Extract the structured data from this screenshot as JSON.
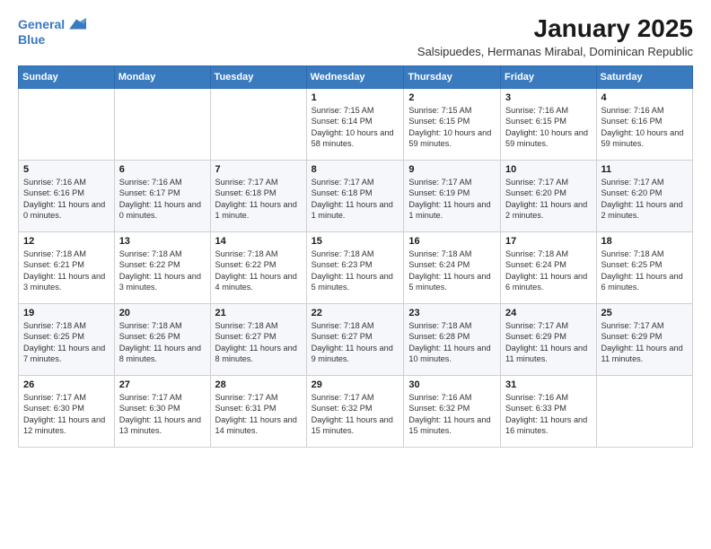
{
  "logo": {
    "line1": "General",
    "line2": "Blue"
  },
  "title": "January 2025",
  "subtitle": "Salsipuedes, Hermanas Mirabal, Dominican Republic",
  "days_of_week": [
    "Sunday",
    "Monday",
    "Tuesday",
    "Wednesday",
    "Thursday",
    "Friday",
    "Saturday"
  ],
  "weeks": [
    [
      {
        "day": "",
        "info": ""
      },
      {
        "day": "",
        "info": ""
      },
      {
        "day": "",
        "info": ""
      },
      {
        "day": "1",
        "info": "Sunrise: 7:15 AM\nSunset: 6:14 PM\nDaylight: 10 hours\nand 58 minutes."
      },
      {
        "day": "2",
        "info": "Sunrise: 7:15 AM\nSunset: 6:15 PM\nDaylight: 10 hours\nand 59 minutes."
      },
      {
        "day": "3",
        "info": "Sunrise: 7:16 AM\nSunset: 6:15 PM\nDaylight: 10 hours\nand 59 minutes."
      },
      {
        "day": "4",
        "info": "Sunrise: 7:16 AM\nSunset: 6:16 PM\nDaylight: 10 hours\nand 59 minutes."
      }
    ],
    [
      {
        "day": "5",
        "info": "Sunrise: 7:16 AM\nSunset: 6:16 PM\nDaylight: 11 hours\nand 0 minutes."
      },
      {
        "day": "6",
        "info": "Sunrise: 7:16 AM\nSunset: 6:17 PM\nDaylight: 11 hours\nand 0 minutes."
      },
      {
        "day": "7",
        "info": "Sunrise: 7:17 AM\nSunset: 6:18 PM\nDaylight: 11 hours\nand 1 minute."
      },
      {
        "day": "8",
        "info": "Sunrise: 7:17 AM\nSunset: 6:18 PM\nDaylight: 11 hours\nand 1 minute."
      },
      {
        "day": "9",
        "info": "Sunrise: 7:17 AM\nSunset: 6:19 PM\nDaylight: 11 hours\nand 1 minute."
      },
      {
        "day": "10",
        "info": "Sunrise: 7:17 AM\nSunset: 6:20 PM\nDaylight: 11 hours\nand 2 minutes."
      },
      {
        "day": "11",
        "info": "Sunrise: 7:17 AM\nSunset: 6:20 PM\nDaylight: 11 hours\nand 2 minutes."
      }
    ],
    [
      {
        "day": "12",
        "info": "Sunrise: 7:18 AM\nSunset: 6:21 PM\nDaylight: 11 hours\nand 3 minutes."
      },
      {
        "day": "13",
        "info": "Sunrise: 7:18 AM\nSunset: 6:22 PM\nDaylight: 11 hours\nand 3 minutes."
      },
      {
        "day": "14",
        "info": "Sunrise: 7:18 AM\nSunset: 6:22 PM\nDaylight: 11 hours\nand 4 minutes."
      },
      {
        "day": "15",
        "info": "Sunrise: 7:18 AM\nSunset: 6:23 PM\nDaylight: 11 hours\nand 5 minutes."
      },
      {
        "day": "16",
        "info": "Sunrise: 7:18 AM\nSunset: 6:24 PM\nDaylight: 11 hours\nand 5 minutes."
      },
      {
        "day": "17",
        "info": "Sunrise: 7:18 AM\nSunset: 6:24 PM\nDaylight: 11 hours\nand 6 minutes."
      },
      {
        "day": "18",
        "info": "Sunrise: 7:18 AM\nSunset: 6:25 PM\nDaylight: 11 hours\nand 6 minutes."
      }
    ],
    [
      {
        "day": "19",
        "info": "Sunrise: 7:18 AM\nSunset: 6:25 PM\nDaylight: 11 hours\nand 7 minutes."
      },
      {
        "day": "20",
        "info": "Sunrise: 7:18 AM\nSunset: 6:26 PM\nDaylight: 11 hours\nand 8 minutes."
      },
      {
        "day": "21",
        "info": "Sunrise: 7:18 AM\nSunset: 6:27 PM\nDaylight: 11 hours\nand 8 minutes."
      },
      {
        "day": "22",
        "info": "Sunrise: 7:18 AM\nSunset: 6:27 PM\nDaylight: 11 hours\nand 9 minutes."
      },
      {
        "day": "23",
        "info": "Sunrise: 7:18 AM\nSunset: 6:28 PM\nDaylight: 11 hours\nand 10 minutes."
      },
      {
        "day": "24",
        "info": "Sunrise: 7:17 AM\nSunset: 6:29 PM\nDaylight: 11 hours\nand 11 minutes."
      },
      {
        "day": "25",
        "info": "Sunrise: 7:17 AM\nSunset: 6:29 PM\nDaylight: 11 hours\nand 11 minutes."
      }
    ],
    [
      {
        "day": "26",
        "info": "Sunrise: 7:17 AM\nSunset: 6:30 PM\nDaylight: 11 hours\nand 12 minutes."
      },
      {
        "day": "27",
        "info": "Sunrise: 7:17 AM\nSunset: 6:30 PM\nDaylight: 11 hours\nand 13 minutes."
      },
      {
        "day": "28",
        "info": "Sunrise: 7:17 AM\nSunset: 6:31 PM\nDaylight: 11 hours\nand 14 minutes."
      },
      {
        "day": "29",
        "info": "Sunrise: 7:17 AM\nSunset: 6:32 PM\nDaylight: 11 hours\nand 15 minutes."
      },
      {
        "day": "30",
        "info": "Sunrise: 7:16 AM\nSunset: 6:32 PM\nDaylight: 11 hours\nand 15 minutes."
      },
      {
        "day": "31",
        "info": "Sunrise: 7:16 AM\nSunset: 6:33 PM\nDaylight: 11 hours\nand 16 minutes."
      },
      {
        "day": "",
        "info": ""
      }
    ]
  ]
}
